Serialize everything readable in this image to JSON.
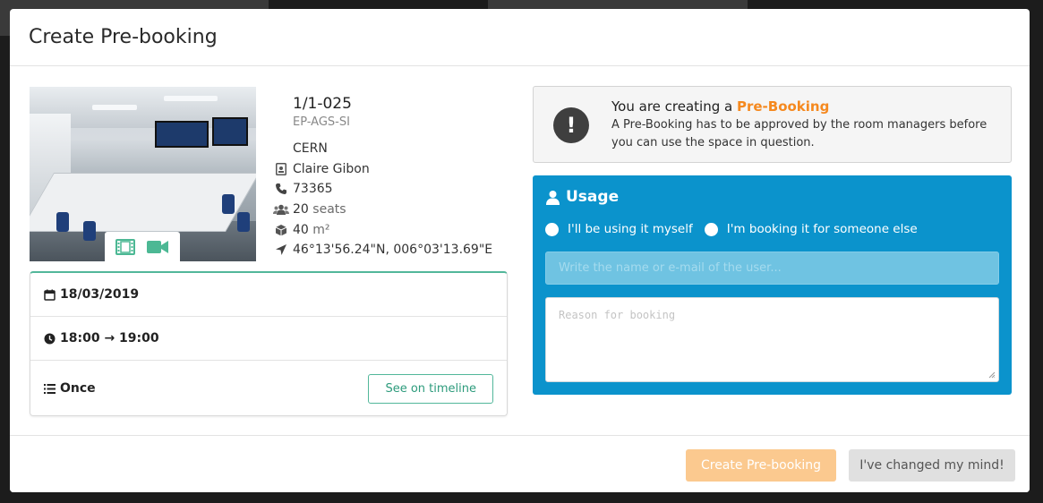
{
  "modal": {
    "title": "Create Pre-booking"
  },
  "room": {
    "name": "1/1-025",
    "group": "EP-AGS-SI",
    "site": "CERN",
    "owner": "Claire Gibon",
    "phone": "73365",
    "seats_value": "20",
    "seats_unit": "seats",
    "surface_value": "40",
    "surface_unit": "m²",
    "coordinates": "46°13'56.24\"N, 006°03'13.69\"E",
    "photo_icons": [
      "film-icon",
      "video-camera-icon"
    ]
  },
  "booking": {
    "date": "18/03/2019",
    "time": "18:00 → 19:00",
    "recurrence": "Once",
    "timeline_button": "See on timeline"
  },
  "notice": {
    "prefix": "You are creating a ",
    "highlight": "Pre-Booking",
    "text": "A Pre-Booking has to be approved by the room managers before you can use the space in question.",
    "highlight_color": "#f5891f"
  },
  "usage": {
    "title": "Usage",
    "option_self": "I'll be using it myself",
    "option_other": "I'm booking it for someone else",
    "user_placeholder": "Write the name or e-mail of the user...",
    "reason_placeholder": "Reason for booking",
    "panel_color": "#0b93cc"
  },
  "footer": {
    "create_label": "Create Pre-booking",
    "cancel_label": "I've changed my mind!"
  }
}
